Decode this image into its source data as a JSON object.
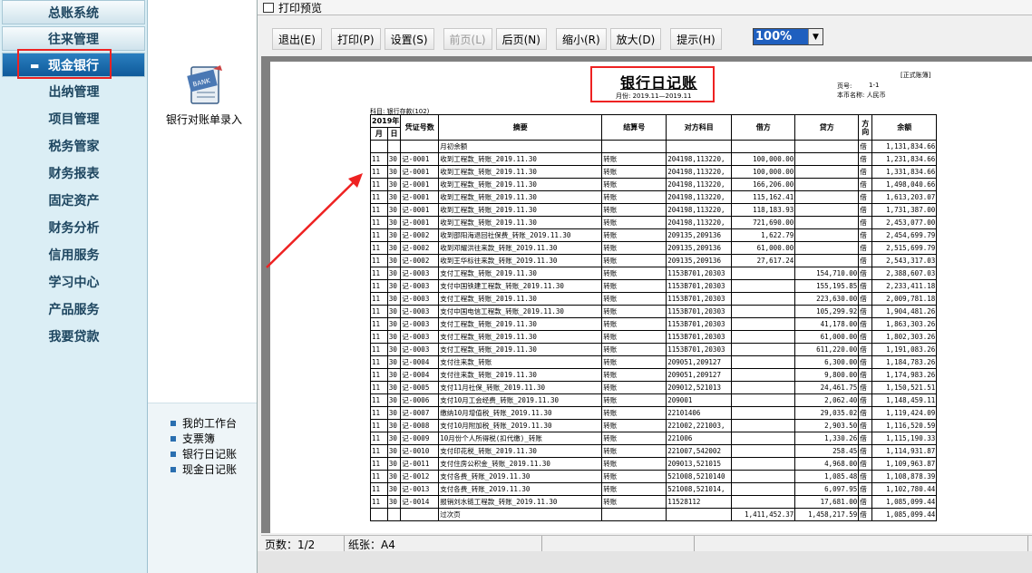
{
  "sidebar": {
    "top_item": "总账系统",
    "items": [
      "往来管理",
      "现金银行"
    ],
    "active_index": 1,
    "subitems": [
      "出纳管理",
      "项目管理",
      "税务管家",
      "财务报表",
      "固定资产",
      "财务分析",
      "信用服务",
      "学习中心",
      "产品服务",
      "我要贷款"
    ]
  },
  "workspace": {
    "app_label": "银行对账单录入",
    "icon": "bank-ledger-icon",
    "quick_links": [
      "我的工作台",
      "支票簿",
      "银行日记账",
      "现金日记账"
    ]
  },
  "window": {
    "title": "打印预览"
  },
  "toolbar": {
    "buttons": [
      "退出(E)",
      "打印(P)",
      "设置(S)",
      "前页(L)",
      "后页(N)",
      "缩小(R)",
      "放大(D)",
      "提示(H)"
    ],
    "disabled_index": 3,
    "zoom": "100%"
  },
  "report": {
    "title": "银行日记账",
    "period": "月份: 2019.11—2019.11",
    "stamp": "[正式账簿]",
    "page_label": "页号:",
    "page_value": "1-1",
    "currency_label": "本币名称: 人民币",
    "account_label": "科目: 银行存款(102)",
    "headers": {
      "year": "2019年",
      "month": "月",
      "day": "日",
      "voucher": "凭证号数",
      "summary": "摘要",
      "settle": "结算号",
      "counter": "对方科目",
      "debit": "借方",
      "credit": "贷方",
      "dir": "方向",
      "balance": "余额"
    },
    "rows": [
      {
        "m": "",
        "d": "",
        "v": "",
        "s": "月初余额",
        "st": "",
        "c": "",
        "dr": "",
        "cr": "",
        "dir": "借",
        "bal": "1,131,834.66"
      },
      {
        "m": "11",
        "d": "30",
        "v": "记-0001",
        "s": "收到工程款_转账_2019.11.30",
        "st": "转账",
        "c": "204198,113220,",
        "dr": "100,000.00",
        "cr": "",
        "dir": "借",
        "bal": "1,231,834.66"
      },
      {
        "m": "11",
        "d": "30",
        "v": "记-0001",
        "s": "收到工程款_转账_2019.11.30",
        "st": "转账",
        "c": "204198,113220,",
        "dr": "100,000.00",
        "cr": "",
        "dir": "借",
        "bal": "1,331,834.66"
      },
      {
        "m": "11",
        "d": "30",
        "v": "记-0001",
        "s": "收到工程款_转账_2019.11.30",
        "st": "转账",
        "c": "204198,113220,",
        "dr": "166,206.00",
        "cr": "",
        "dir": "借",
        "bal": "1,498,040.66"
      },
      {
        "m": "11",
        "d": "30",
        "v": "记-0001",
        "s": "收到工程款_转账_2019.11.30",
        "st": "转账",
        "c": "204198,113220,",
        "dr": "115,162.41",
        "cr": "",
        "dir": "借",
        "bal": "1,613,203.07"
      },
      {
        "m": "11",
        "d": "30",
        "v": "记-0001",
        "s": "收到工程款_转账_2019.11.30",
        "st": "转账",
        "c": "204198,113220,",
        "dr": "118,183.93",
        "cr": "",
        "dir": "借",
        "bal": "1,731,387.00"
      },
      {
        "m": "11",
        "d": "30",
        "v": "记-0001",
        "s": "收到工程款_转账_2019.11.30",
        "st": "转账",
        "c": "204198,113220,",
        "dr": "721,690.00",
        "cr": "",
        "dir": "借",
        "bal": "2,453,077.00"
      },
      {
        "m": "11",
        "d": "30",
        "v": "记-0002",
        "s": "收到邵阳海退回社保费_转账_2019.11.30",
        "st": "转账",
        "c": "209135,209136",
        "dr": "1,622.79",
        "cr": "",
        "dir": "借",
        "bal": "2,454,699.79"
      },
      {
        "m": "11",
        "d": "30",
        "v": "记-0002",
        "s": "收到邓耀洪往来款_转账_2019.11.30",
        "st": "转账",
        "c": "209135,209136",
        "dr": "61,000.00",
        "cr": "",
        "dir": "借",
        "bal": "2,515,699.79"
      },
      {
        "m": "11",
        "d": "30",
        "v": "记-0002",
        "s": "收到王华标往来款_转账_2019.11.30",
        "st": "转账",
        "c": "209135,209136",
        "dr": "27,617.24",
        "cr": "",
        "dir": "借",
        "bal": "2,543,317.03"
      },
      {
        "m": "11",
        "d": "30",
        "v": "记-0003",
        "s": "支付工程款_转账_2019.11.30",
        "st": "转账",
        "c": "1153B701,20303",
        "dr": "",
        "cr": "154,710.00",
        "dir": "借",
        "bal": "2,388,607.03"
      },
      {
        "m": "11",
        "d": "30",
        "v": "记-0003",
        "s": "支付中国铁建工程款_转账_2019.11.30",
        "st": "转账",
        "c": "1153B701,20303",
        "dr": "",
        "cr": "155,195.85",
        "dir": "借",
        "bal": "2,233,411.18"
      },
      {
        "m": "11",
        "d": "30",
        "v": "记-0003",
        "s": "支付工程款_转账_2019.11.30",
        "st": "转账",
        "c": "1153B701,20303",
        "dr": "",
        "cr": "223,630.00",
        "dir": "借",
        "bal": "2,009,781.18"
      },
      {
        "m": "11",
        "d": "30",
        "v": "记-0003",
        "s": "支付中国电信工程款_转账_2019.11.30",
        "st": "转账",
        "c": "1153B701,20303",
        "dr": "",
        "cr": "105,299.92",
        "dir": "借",
        "bal": "1,904,481.26"
      },
      {
        "m": "11",
        "d": "30",
        "v": "记-0003",
        "s": "支付工程款_转账_2019.11.30",
        "st": "转账",
        "c": "1153B701,20303",
        "dr": "",
        "cr": "41,178.00",
        "dir": "借",
        "bal": "1,863,303.26"
      },
      {
        "m": "11",
        "d": "30",
        "v": "记-0003",
        "s": "支付工程款_转账_2019.11.30",
        "st": "转账",
        "c": "1153B701,20303",
        "dr": "",
        "cr": "61,000.00",
        "dir": "借",
        "bal": "1,802,303.26"
      },
      {
        "m": "11",
        "d": "30",
        "v": "记-0003",
        "s": "支付工程款_转账_2019.11.30",
        "st": "转账",
        "c": "1153B701,20303",
        "dr": "",
        "cr": "611,220.00",
        "dir": "借",
        "bal": "1,191,083.26"
      },
      {
        "m": "11",
        "d": "30",
        "v": "记-0004",
        "s": "支付往来款_转账",
        "st": "转账",
        "c": "209051,209127",
        "dr": "",
        "cr": "6,300.00",
        "dir": "借",
        "bal": "1,184,783.26"
      },
      {
        "m": "11",
        "d": "30",
        "v": "记-0004",
        "s": "支付往来款_转账_2019.11.30",
        "st": "转账",
        "c": "209051,209127",
        "dr": "",
        "cr": "9,800.00",
        "dir": "借",
        "bal": "1,174,983.26"
      },
      {
        "m": "11",
        "d": "30",
        "v": "记-0005",
        "s": "支付11月社保_转账_2019.11.30",
        "st": "转账",
        "c": "209012,521013",
        "dr": "",
        "cr": "24,461.75",
        "dir": "借",
        "bal": "1,150,521.51"
      },
      {
        "m": "11",
        "d": "30",
        "v": "记-0006",
        "s": "支付10月工会经费_转账_2019.11.30",
        "st": "转账",
        "c": "209001",
        "dr": "",
        "cr": "2,062.40",
        "dir": "借",
        "bal": "1,148,459.11"
      },
      {
        "m": "11",
        "d": "30",
        "v": "记-0007",
        "s": "缴纳10月增值税_转账_2019.11.30",
        "st": "转账",
        "c": "22101406",
        "dr": "",
        "cr": "29,035.02",
        "dir": "借",
        "bal": "1,119,424.09"
      },
      {
        "m": "11",
        "d": "30",
        "v": "记-0008",
        "s": "支付10月附加税_转账_2019.11.30",
        "st": "转账",
        "c": "221002,221003,",
        "dr": "",
        "cr": "2,903.50",
        "dir": "借",
        "bal": "1,116,520.59"
      },
      {
        "m": "11",
        "d": "30",
        "v": "记-0009",
        "s": "10月份个人所得税(扣代缴)_转账",
        "st": "转账",
        "c": "221006",
        "dr": "",
        "cr": "1,330.26",
        "dir": "借",
        "bal": "1,115,190.33"
      },
      {
        "m": "11",
        "d": "30",
        "v": "记-0010",
        "s": "支付印花税_转账_2019.11.30",
        "st": "转账",
        "c": "221007,542002",
        "dr": "",
        "cr": "258.45",
        "dir": "借",
        "bal": "1,114,931.87"
      },
      {
        "m": "11",
        "d": "30",
        "v": "记-0011",
        "s": "支付住房公积金_转账_2019.11.30",
        "st": "转账",
        "c": "209013,521015",
        "dr": "",
        "cr": "4,968.00",
        "dir": "借",
        "bal": "1,109,963.87"
      },
      {
        "m": "11",
        "d": "30",
        "v": "记-0012",
        "s": "支付各费_转账_2019.11.30",
        "st": "转账",
        "c": "521008,5210140",
        "dr": "",
        "cr": "1,085.48",
        "dir": "借",
        "bal": "1,108,878.39"
      },
      {
        "m": "11",
        "d": "30",
        "v": "记-0013",
        "s": "支付各费_转账_2019.11.30",
        "st": "转账",
        "c": "521008,521014,",
        "dr": "",
        "cr": "6,097.95",
        "dir": "借",
        "bal": "1,102,780.44"
      },
      {
        "m": "11",
        "d": "30",
        "v": "记-0014",
        "s": "报销刘水链工程款_转账_2019.11.30",
        "st": "转账",
        "c": "11528112",
        "dr": "",
        "cr": "17,681.00",
        "dir": "借",
        "bal": "1,085,099.44"
      },
      {
        "m": "",
        "d": "",
        "v": "",
        "s": "过次页",
        "st": "",
        "c": "",
        "dr": "1,411,452.37",
        "cr": "1,458,217.59",
        "dir": "借",
        "bal": "1,085,099.44"
      }
    ]
  },
  "status": {
    "pages": "页数：1/2",
    "paper": "纸张：A4"
  }
}
